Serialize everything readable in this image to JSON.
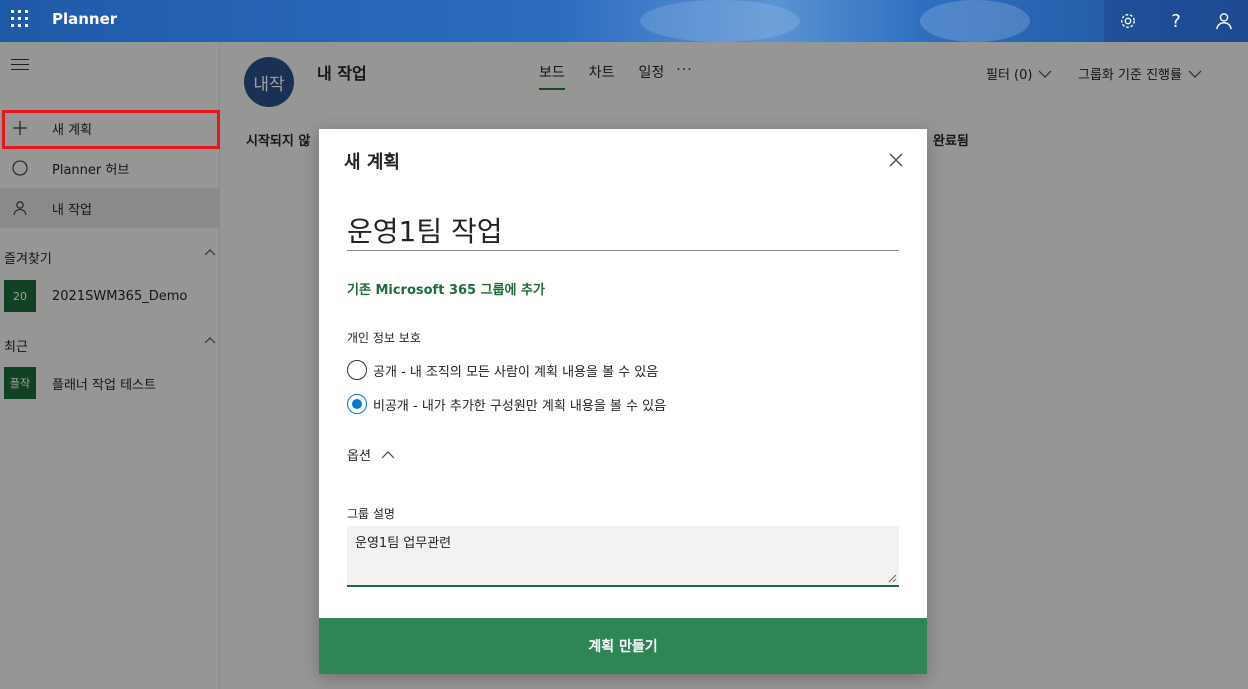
{
  "app": {
    "title": "Planner"
  },
  "sidebar": {
    "items": [
      {
        "label": "새 계획",
        "icon": "plus-icon"
      },
      {
        "label": "Planner 허브",
        "icon": "circle-icon"
      },
      {
        "label": "내 작업",
        "icon": "person-icon"
      }
    ],
    "favorites_header": "즐겨찾기",
    "favorites": [
      {
        "tile": "20",
        "label": "2021SWM365_Demo"
      }
    ],
    "recent_header": "최근",
    "recent": [
      {
        "tile": "플작",
        "label": "플래너 작업 테스트"
      }
    ]
  },
  "header": {
    "avatar": "내작",
    "title": "내 작업",
    "tabs": [
      {
        "label": "보드",
        "active": true
      },
      {
        "label": "차트"
      },
      {
        "label": "일정"
      }
    ],
    "more": "···",
    "filter": "필터 (0)",
    "grouping": "그룹화 기준 진행률"
  },
  "buckets": {
    "left": "시작되지 않",
    "right": "완료됨"
  },
  "dialog": {
    "title": "새 계획",
    "plan_name": "운영1팀 작업",
    "add_to_group": "기존 Microsoft 365 그룹에 추가",
    "privacy_label": "개인 정보 보호",
    "privacy_options": [
      {
        "label": "공개 - 내 조직의 모든 사람이 계획 내용을 볼 수 있음",
        "checked": false
      },
      {
        "label": "비공개 - 내가 추가한 구성원만 계획 내용을 볼 수 있음",
        "checked": true
      }
    ],
    "options_label": "옵션",
    "description_label": "그룹 설명",
    "description_value": "운영1팀 업무관련",
    "create_button": "계획 만들기"
  },
  "colors": {
    "brand_green": "#2e8656",
    "topbar_blue": "#2d6cbf",
    "highlight_red": "#e8161b",
    "radio_blue": "#0078d4"
  }
}
